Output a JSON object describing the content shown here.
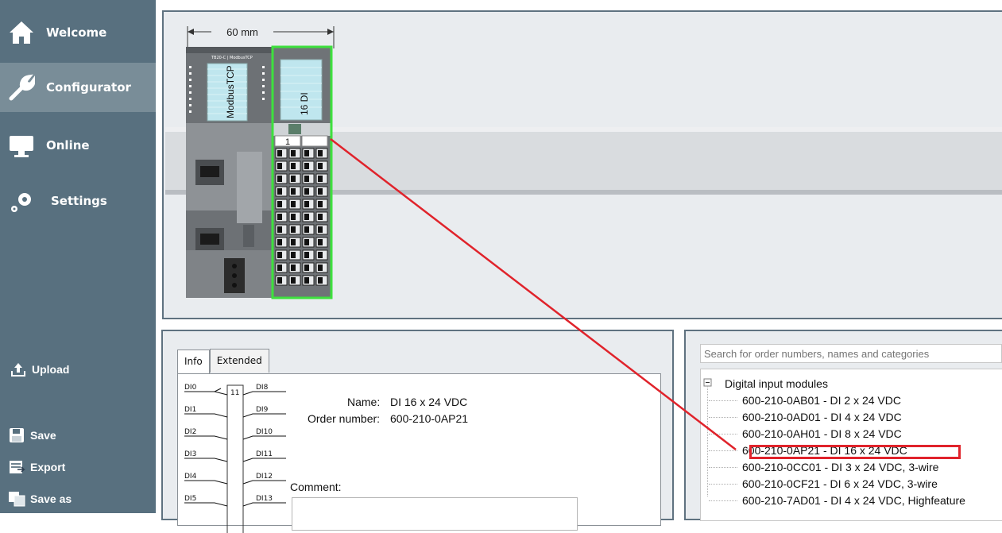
{
  "sidebar": {
    "nav": [
      {
        "label": "Welcome",
        "icon": "home-icon"
      },
      {
        "label": "Configurator",
        "icon": "wrench-icon",
        "active": true
      },
      {
        "label": "Online",
        "icon": "monitor-icon"
      },
      {
        "label": "Settings",
        "icon": "gears-icon"
      }
    ],
    "upload": "Upload",
    "save": "Save",
    "export": "Export",
    "save_as": "Save as"
  },
  "rack": {
    "width_label": "60 mm",
    "cpu_label": "ModbusTCP",
    "cpu_small_text": "TB20-C | ModbusTCP",
    "module_label": "16 DI",
    "slot_number": "1"
  },
  "info": {
    "tabs": [
      "Info",
      "Extended"
    ],
    "active_tab": "Info",
    "name_label": "Name:",
    "name_value": "DI 16 x 24 VDC",
    "order_label": "Order number:",
    "order_value": "600-210-0AP21",
    "comment_label": "Comment:",
    "diagram_left": [
      "DI0",
      "DI1",
      "DI2",
      "DI3",
      "DI4",
      "DI5"
    ],
    "diagram_right": [
      "DI8",
      "DI9",
      "DI10",
      "DI11",
      "DI12",
      "DI13"
    ],
    "diagram_marker": "11"
  },
  "catalog": {
    "search_placeholder": "Search for order numbers, names and categories",
    "category": "Digital input modules",
    "items": [
      "600-210-0AB01 - DI 2 x 24 VDC",
      "600-210-0AD01 - DI 4 x 24 VDC",
      "600-210-0AH01 - DI 8 x 24 VDC",
      "600-210-0AP21 - DI 16 x 24 VDC",
      "600-210-0CC01 - DI 3 x 24 VDC, 3-wire",
      "600-210-0CF21 - DI 6 x 24 VDC, 3-wire",
      "600-210-7AD01 - DI 4 x 24 VDC, Highfeature"
    ],
    "selected_index": 3
  },
  "colors": {
    "sidebar": "#58707f",
    "sidebar_active": "#798d98",
    "highlight_red": "#e0232b",
    "module_selected_green": "#3ee03e"
  }
}
